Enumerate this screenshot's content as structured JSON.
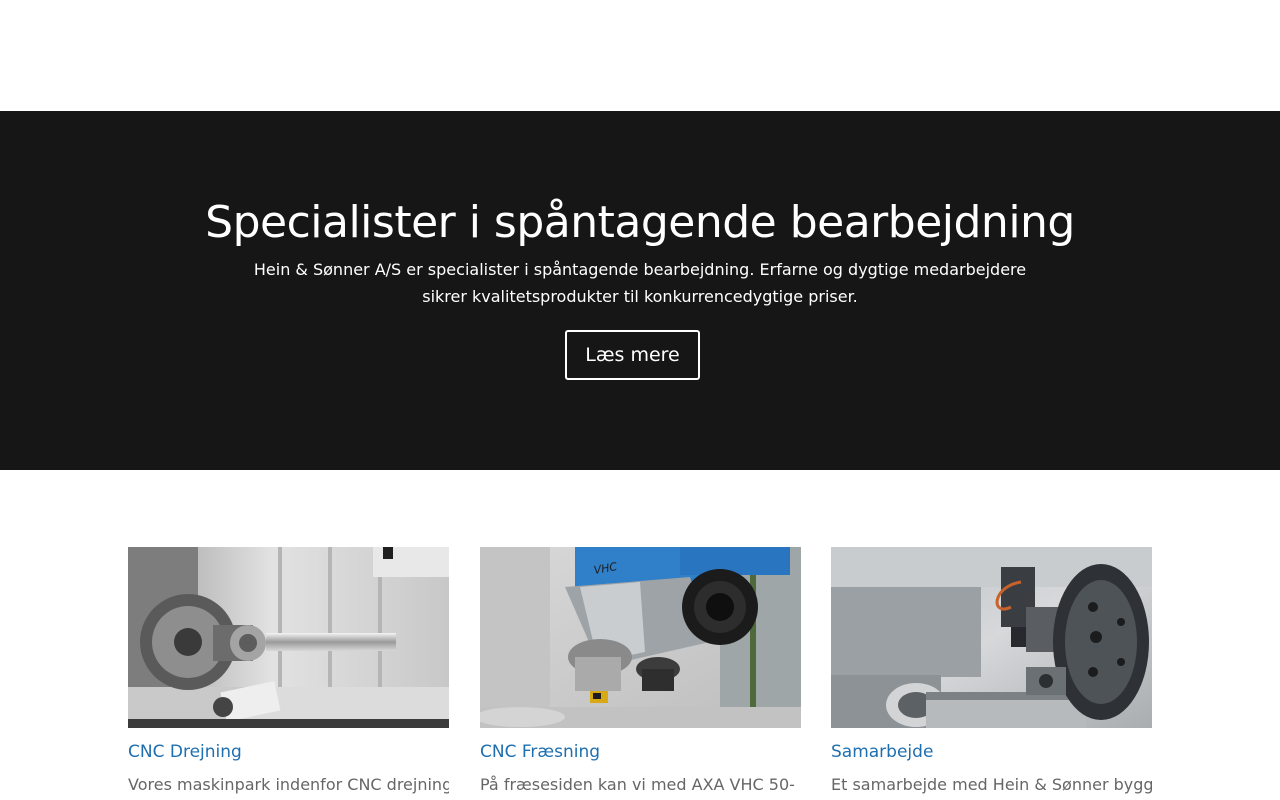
{
  "hero": {
    "title": "Specialister i spåntagende bearbejdning",
    "description": "Hein & Sønner A/S er specialister i spåntagende bearbejdning. Erfarne og dygtige medarbejdere sikrer kvalitetsprodukter til konkurrencedygtige priser.",
    "button_label": "Læs mere"
  },
  "services": [
    {
      "title": "CNC Drejning",
      "text": "Vores maskinpark indenfor CNC drejning",
      "image": "cnc-lathe-photo"
    },
    {
      "title": "CNC Fræsning",
      "text": "På fræsesiden kan vi med AXA VHC 50-",
      "image": "cnc-milling-head-photo"
    },
    {
      "title": "Samarbejde",
      "text": "Et samarbejde med Hein & Sønner bygger",
      "image": "machined-part-photo"
    }
  ],
  "colors": {
    "hero_background": "#161616",
    "link": "#1e6fb0",
    "body_text": "#666666"
  }
}
